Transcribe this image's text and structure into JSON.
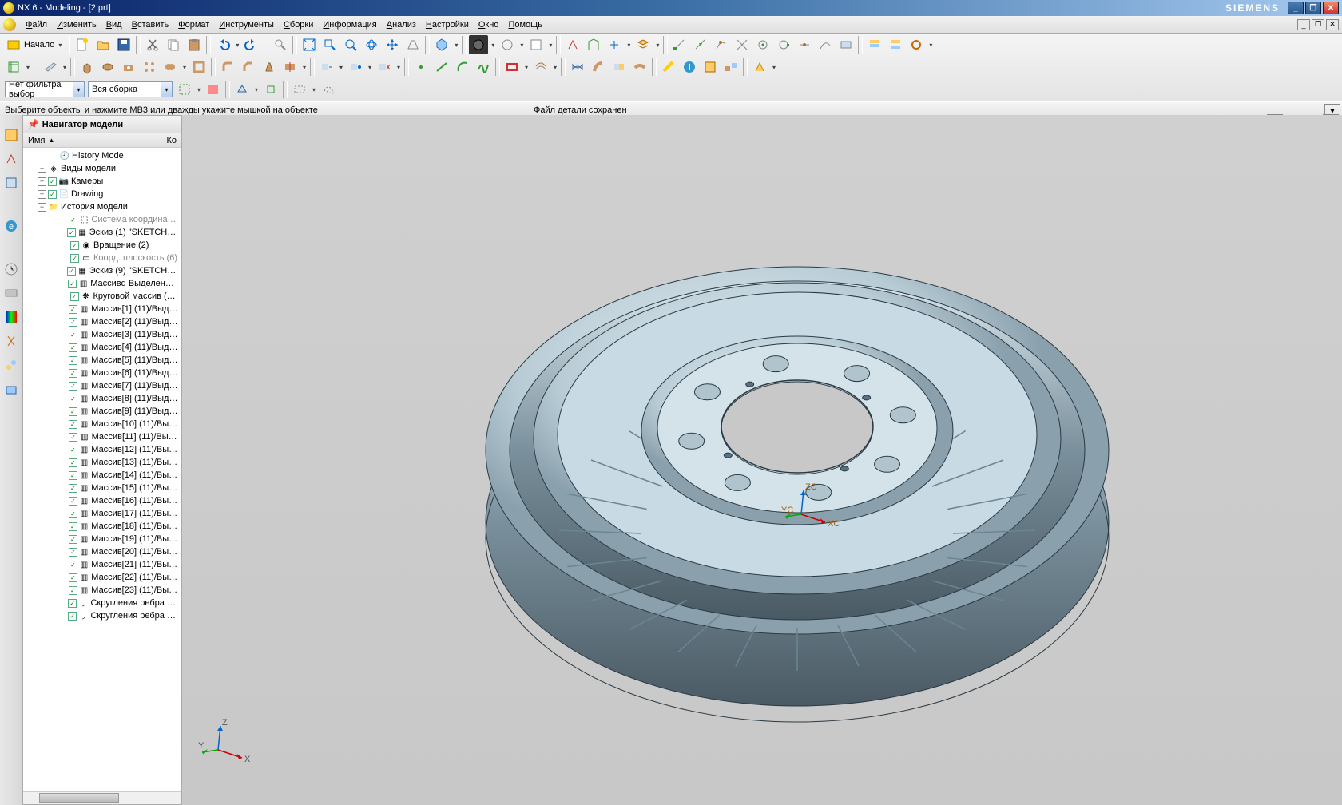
{
  "title": "NX 6 - Modeling - [2.prt]",
  "brand": "SIEMENS",
  "menu": [
    "Файл",
    "Изменить",
    "Вид",
    "Вставить",
    "Формат",
    "Инструменты",
    "Сборки",
    "Информация",
    "Анализ",
    "Настройки",
    "Окно",
    "Помощь"
  ],
  "start_label": "Начало",
  "filter_combo": "Нет фильтра выбор",
  "assembly_combo": "Вся сборка",
  "prompt_left": "Выберите объекты и нажмите МВ3 или дважды укажите мышкой на объекте",
  "prompt_right": "Файл детали сохранен",
  "navigator": {
    "title": "Навигатор модели",
    "col_name": "Имя",
    "col_k": "Ко"
  },
  "tree": [
    {
      "indent": 1,
      "exp": "",
      "chk": false,
      "icon": "🕘",
      "label": "History Mode",
      "grey": false
    },
    {
      "indent": 0,
      "exp": "+",
      "chk": false,
      "icon": "◈",
      "label": "Виды модели",
      "grey": false
    },
    {
      "indent": 0,
      "exp": "+",
      "chk": true,
      "icon": "📷",
      "label": "Камеры",
      "grey": false
    },
    {
      "indent": 0,
      "exp": "+",
      "chk": true,
      "icon": "📄",
      "label": "Drawing",
      "grey": false
    },
    {
      "indent": 0,
      "exp": "-",
      "chk": false,
      "icon": "📁",
      "label": "История модели",
      "grey": false
    },
    {
      "indent": 2,
      "exp": "",
      "chk": true,
      "icon": "⬚",
      "label": "Система координат ...",
      "grey": true
    },
    {
      "indent": 2,
      "exp": "",
      "chk": true,
      "icon": "▦",
      "label": "Эскиз (1) \"SKETCH_0...",
      "grey": false
    },
    {
      "indent": 2,
      "exp": "",
      "chk": true,
      "icon": "◉",
      "label": "Вращение (2)",
      "grey": false
    },
    {
      "indent": 2,
      "exp": "",
      "chk": true,
      "icon": "▭",
      "label": "Коорд. плоскость (6)",
      "grey": true
    },
    {
      "indent": 2,
      "exp": "",
      "chk": true,
      "icon": "▦",
      "label": "Эскиз (9) \"SKETCH_0...",
      "grey": false
    },
    {
      "indent": 2,
      "exp": "",
      "chk": true,
      "icon": "▥",
      "label": "Массивd Выделение...",
      "grey": false
    },
    {
      "indent": 2,
      "exp": "",
      "chk": true,
      "icon": "❋",
      "label": "Круговой массив (11)",
      "grey": false
    },
    {
      "indent": 2,
      "exp": "",
      "chk": true,
      "icon": "▥",
      "label": "Массив[1] (11)/Выде...",
      "grey": false
    },
    {
      "indent": 2,
      "exp": "",
      "chk": true,
      "icon": "▥",
      "label": "Массив[2] (11)/Выде...",
      "grey": false
    },
    {
      "indent": 2,
      "exp": "",
      "chk": true,
      "icon": "▥",
      "label": "Массив[3] (11)/Выде...",
      "grey": false
    },
    {
      "indent": 2,
      "exp": "",
      "chk": true,
      "icon": "▥",
      "label": "Массив[4] (11)/Выде...",
      "grey": false
    },
    {
      "indent": 2,
      "exp": "",
      "chk": true,
      "icon": "▥",
      "label": "Массив[5] (11)/Выде...",
      "grey": false
    },
    {
      "indent": 2,
      "exp": "",
      "chk": true,
      "icon": "▥",
      "label": "Массив[6] (11)/Выде...",
      "grey": false
    },
    {
      "indent": 2,
      "exp": "",
      "chk": true,
      "icon": "▥",
      "label": "Массив[7] (11)/Выде...",
      "grey": false
    },
    {
      "indent": 2,
      "exp": "",
      "chk": true,
      "icon": "▥",
      "label": "Массив[8] (11)/Выде...",
      "grey": false
    },
    {
      "indent": 2,
      "exp": "",
      "chk": true,
      "icon": "▥",
      "label": "Массив[9] (11)/Выде...",
      "grey": false
    },
    {
      "indent": 2,
      "exp": "",
      "chk": true,
      "icon": "▥",
      "label": "Массив[10] (11)/Выд...",
      "grey": false
    },
    {
      "indent": 2,
      "exp": "",
      "chk": true,
      "icon": "▥",
      "label": "Массив[11] (11)/Выд...",
      "grey": false
    },
    {
      "indent": 2,
      "exp": "",
      "chk": true,
      "icon": "▥",
      "label": "Массив[12] (11)/Выд...",
      "grey": false
    },
    {
      "indent": 2,
      "exp": "",
      "chk": true,
      "icon": "▥",
      "label": "Массив[13] (11)/Выд...",
      "grey": false
    },
    {
      "indent": 2,
      "exp": "",
      "chk": true,
      "icon": "▥",
      "label": "Массив[14] (11)/Выд...",
      "grey": false
    },
    {
      "indent": 2,
      "exp": "",
      "chk": true,
      "icon": "▥",
      "label": "Массив[15] (11)/Выд...",
      "grey": false
    },
    {
      "indent": 2,
      "exp": "",
      "chk": true,
      "icon": "▥",
      "label": "Массив[16] (11)/Выд...",
      "grey": false
    },
    {
      "indent": 2,
      "exp": "",
      "chk": true,
      "icon": "▥",
      "label": "Массив[17] (11)/Выд...",
      "grey": false
    },
    {
      "indent": 2,
      "exp": "",
      "chk": true,
      "icon": "▥",
      "label": "Массив[18] (11)/Выд...",
      "grey": false
    },
    {
      "indent": 2,
      "exp": "",
      "chk": true,
      "icon": "▥",
      "label": "Массив[19] (11)/Выд...",
      "grey": false
    },
    {
      "indent": 2,
      "exp": "",
      "chk": true,
      "icon": "▥",
      "label": "Массив[20] (11)/Выд...",
      "grey": false
    },
    {
      "indent": 2,
      "exp": "",
      "chk": true,
      "icon": "▥",
      "label": "Массив[21] (11)/Выд...",
      "grey": false
    },
    {
      "indent": 2,
      "exp": "",
      "chk": true,
      "icon": "▥",
      "label": "Массив[22] (11)/Выд...",
      "grey": false
    },
    {
      "indent": 2,
      "exp": "",
      "chk": true,
      "icon": "▥",
      "label": "Массив[23] (11)/Выд...",
      "grey": false
    },
    {
      "indent": 2,
      "exp": "",
      "chk": true,
      "icon": "◞",
      "label": "Скругления ребра (1...",
      "grey": false
    },
    {
      "indent": 2,
      "exp": "",
      "chk": true,
      "icon": "◞",
      "label": "Скругления ребра (1...",
      "grey": false
    }
  ],
  "axis_labels": {
    "x": "XC",
    "y": "YC",
    "z": "ZC",
    "wx": "X",
    "wy": "Y",
    "wz": "Z"
  }
}
